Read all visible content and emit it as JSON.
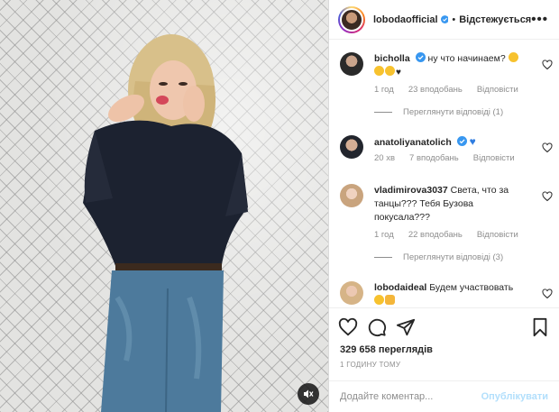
{
  "post": {
    "author": "lobodaofficial",
    "follow_state": "Відстежується",
    "separator": "•",
    "more": "•••"
  },
  "comments": [
    {
      "user": "bicholla",
      "verified": true,
      "text": "ну что начинаем?",
      "emojis": [
        "heart-eyes",
        "heart-eyes",
        "heart-eyes",
        "black-heart"
      ],
      "time": "1 год",
      "likes": "23 вподобань",
      "reply": "Відповісти",
      "view_replies": "Переглянути відповіді (1)"
    },
    {
      "user": "anatoliyanatolich",
      "verified": true,
      "text": "",
      "emojis": [
        "blue-heart"
      ],
      "time": "20 хв",
      "likes": "7 вподобань",
      "reply": "Відповісти"
    },
    {
      "user": "vladimirova3037",
      "verified": false,
      "text": "Света, что за танцы??? Тебя Бузова покусала???",
      "time": "1 год",
      "likes": "22 вподобань",
      "reply": "Відповісти",
      "view_replies": "Переглянути відповіді (3)"
    },
    {
      "user": "lobodaideal",
      "verified": false,
      "text": "Будем участвовать",
      "emojis": [
        "smile",
        "thumbs-up"
      ]
    }
  ],
  "stats": {
    "views": "329 658 переглядів",
    "time_ago": "1 ГОДИНУ ТОМУ"
  },
  "composer": {
    "placeholder": "Додайте коментар...",
    "publish": "Опублікувати"
  },
  "icons": [
    "heart-icon",
    "comment-icon",
    "share-icon",
    "bookmark-icon",
    "emoji-icon",
    "mute-icon",
    "verified-badge-icon",
    "more-icon"
  ],
  "colors": {
    "verified": "#3897f0",
    "publish": "#b2dffc",
    "meta": "#8e8e8e",
    "text": "#262626"
  }
}
